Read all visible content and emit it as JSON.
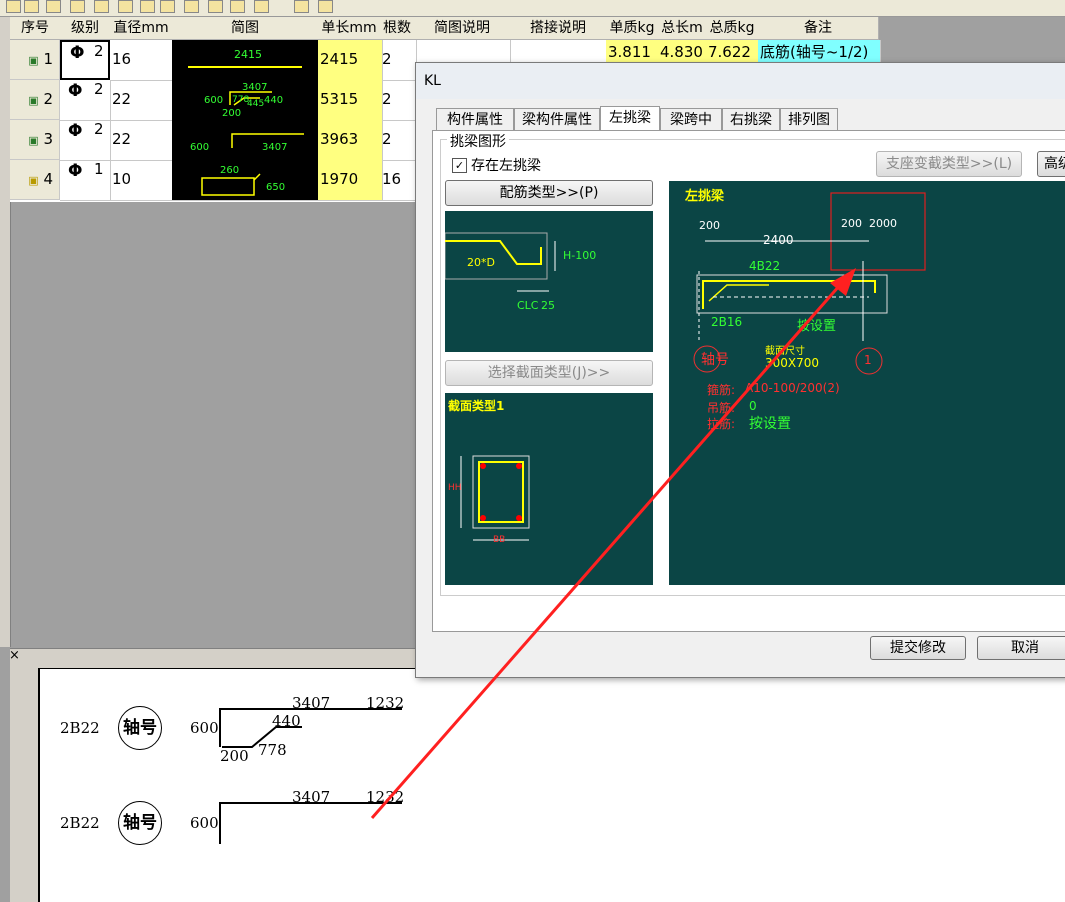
{
  "table": {
    "headers": [
      "序号",
      "级别",
      "直径mm",
      "简图",
      "单长mm",
      "根数",
      "简图说明",
      "搭接说明",
      "单质kg",
      "总长m",
      "总质kg",
      "备注"
    ],
    "rows": [
      {
        "no": "1",
        "grade": "2",
        "dia": "16",
        "len": "2415",
        "count": "2"
      },
      {
        "no": "2",
        "grade": "2",
        "dia": "22",
        "len": "5315",
        "count": "2"
      },
      {
        "no": "3",
        "grade": "2",
        "dia": "22",
        "len": "3963",
        "count": "2"
      },
      {
        "no": "4",
        "grade": "1",
        "dia": "10",
        "len": "1970",
        "count": "16"
      }
    ],
    "grade_symbol": "Φ",
    "row1_extra": {
      "unit_kg": "3.811",
      "total_m": "4.830",
      "total_kg": "7.622",
      "note": "底筋(轴号~1/2)"
    },
    "thumbs": {
      "r1": [
        "2415"
      ],
      "r2": [
        "600",
        "3407",
        "778",
        "445",
        "440",
        "200"
      ],
      "r3": [
        "600",
        "3407"
      ],
      "r4": [
        "260",
        "650"
      ]
    }
  },
  "dialog": {
    "title": "KL",
    "tabs": [
      "构件属性",
      "梁构件属性",
      "左挑梁",
      "梁跨中",
      "右挑梁",
      "排列图"
    ],
    "active_tab": 2,
    "group_label": "挑梁图形",
    "checkbox_label": "存在左挑梁",
    "checked": true,
    "btn_rebar_type": "配筋类型>>(P)",
    "btn_section_type": "选择截面类型(J)>>",
    "btn_support_type": "支座变截类型>>(L)",
    "btn_advanced": "高级",
    "btn_submit": "提交修改",
    "btn_cancel": "取消",
    "rebar_preview": {
      "t1": "20*D",
      "t2": "H-100",
      "t3": "CLC",
      "t4": "25"
    },
    "section_preview": {
      "title": "截面类型1",
      "h": "HH",
      "b": "BB"
    },
    "main_preview": {
      "title": "左挑梁",
      "dims": [
        "200",
        "2400",
        "200",
        "2000"
      ],
      "top_bar": "4B22",
      "bottom_bar": "2B16",
      "set_label": "按设置",
      "axis_label": "轴号",
      "axis_num": "1",
      "section_size_label": "截面尺寸",
      "section_size": "300X700",
      "stirrup_label": "箍筋:",
      "stirrup": "A10-100/200(2)",
      "hanger_label": "吊筋:",
      "hanger": "0",
      "tie_label": "拉筋:",
      "tie": "按设置"
    }
  },
  "cad": {
    "rows": [
      {
        "bar": "2B22",
        "axis": "轴号",
        "d600": "600",
        "d3407": "3407",
        "d1232": "1232",
        "d440": "440",
        "d200": "200",
        "d778": "778"
      },
      {
        "bar": "2B22",
        "axis": "轴号",
        "d600": "600",
        "d3407": "3407",
        "d1232": "1232"
      }
    ]
  },
  "close_glyph": "×",
  "colors": {
    "accent_red": "#ff2020",
    "preview_bg": "#0b4545",
    "cell_yellow": "#ffff80",
    "cell_cyan": "#80ffff"
  }
}
